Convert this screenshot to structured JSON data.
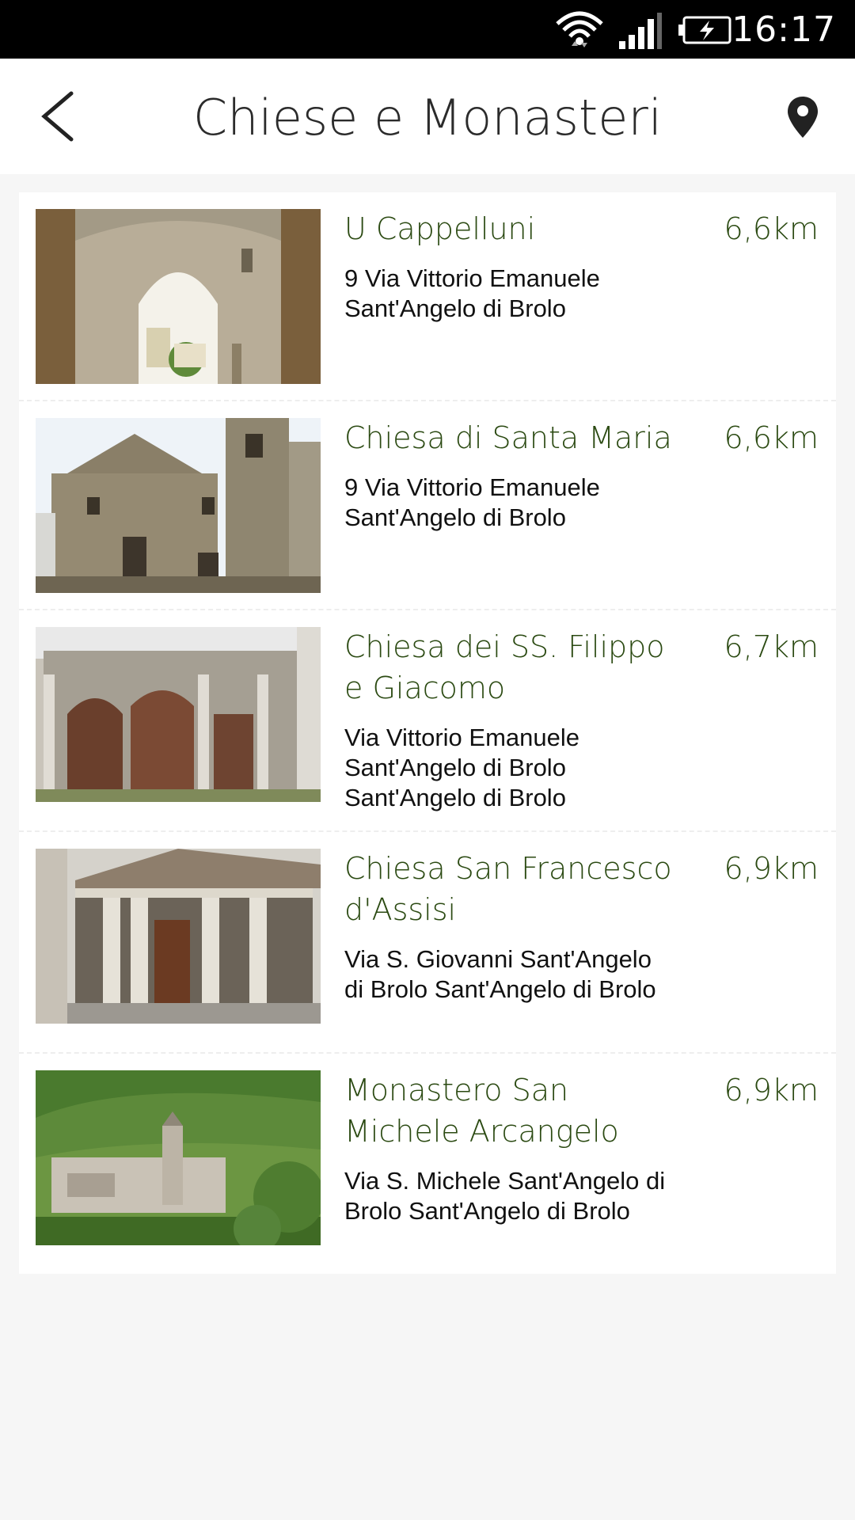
{
  "status_bar": {
    "time": "16:17",
    "icons": [
      "wifi-icon",
      "signal-icon",
      "battery-charging-icon"
    ]
  },
  "app_bar": {
    "back_icon": "chevron-left-icon",
    "title": "Chiese e Monasteri",
    "map_icon": "location-pin-icon"
  },
  "colors": {
    "title_green": "#2b4a12",
    "background": "#f6f6f6",
    "card": "#ffffff"
  },
  "places": [
    {
      "name": "U Cappelluni",
      "distance": "6,6km",
      "address": "9 Via Vittorio Emanuele Sant'Angelo di Brolo",
      "image": "stone-arch-gateway-photo"
    },
    {
      "name": "Chiesa di Santa Maria",
      "distance": "6,6km",
      "address": "9 Via Vittorio Emanuele Sant'Angelo di Brolo",
      "image": "church-facade-with-bell-tower-photo"
    },
    {
      "name": "Chiesa dei SS. Filippo e Giacomo",
      "distance": "6,7km",
      "address": "Via Vittorio Emanuele Sant'Angelo di Brolo Sant'Angelo di Brolo",
      "image": "baroque-portals-photo"
    },
    {
      "name": "Chiesa San Francesco d'Assisi",
      "distance": "6,9km",
      "address": "Via S. Giovanni Sant'Angelo di Brolo Sant'Angelo di Brolo",
      "image": "columned-portico-photo"
    },
    {
      "name": "Monastero San Michele Arcangelo",
      "distance": "6,9km",
      "address": "Via S. Michele Sant'Angelo di Brolo Sant'Angelo di Brolo",
      "image": "hillside-village-photo"
    }
  ]
}
